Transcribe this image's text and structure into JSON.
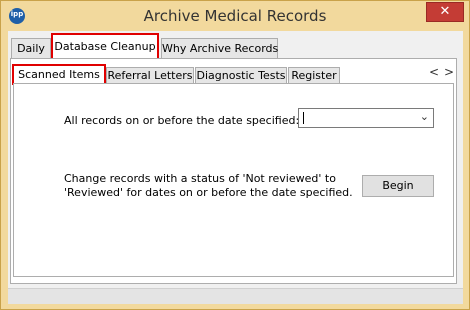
{
  "window": {
    "title": "Archive Medical Records",
    "app_icon_text": "ipp",
    "close_glyph": "✕"
  },
  "outer_tabs": [
    {
      "label": "Daily"
    },
    {
      "label": "Database Cleanup"
    },
    {
      "label": "Why Archive Records"
    }
  ],
  "inner_tabs": [
    {
      "label": "Scanned Items"
    },
    {
      "label": "Referral Letters"
    },
    {
      "label": "Diagnostic Tests"
    },
    {
      "label": "Register"
    }
  ],
  "tab_scroll": {
    "left": "<",
    "right": ">"
  },
  "content": {
    "date_label": "All records on or before the date specified:",
    "date_value": "",
    "dropdown_glyph": "⌄",
    "change_text_line1": "Change records with a status of 'Not reviewed' to",
    "change_text_line2": "'Reviewed' for dates on or before the date specified.",
    "begin_label": "Begin"
  },
  "colors": {
    "title_bar": "#f2d99d",
    "close_button": "#c43c35",
    "highlight": "#e00000"
  }
}
